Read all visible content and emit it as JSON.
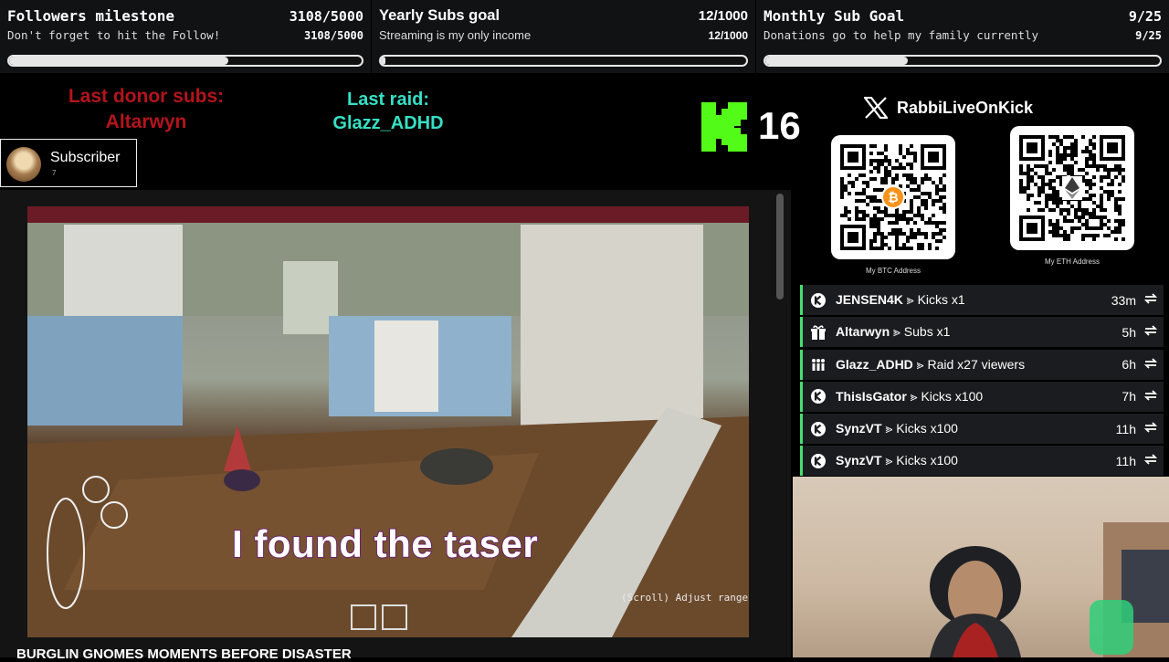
{
  "goals": [
    {
      "title": "Followers milestone",
      "count": "3108/5000",
      "subtitle": "Don't forget to hit the Follow!",
      "subcount": "3108/5000",
      "progress": 0.6216
    },
    {
      "title": "Yearly Subs goal",
      "count": "12/1000",
      "subtitle": "Streaming is my only income",
      "subcount": "12/1000",
      "progress": 0.012
    },
    {
      "title": "Monthly Sub Goal",
      "count": "9/25",
      "subtitle": "Donations go to help my family currently",
      "subcount": "9/25",
      "progress": 0.36
    }
  ],
  "last_donor": {
    "label": "Last donor subs:",
    "name": "Altarwyn"
  },
  "last_raid": {
    "label": "Last raid:",
    "name": "Glazz_ADHD"
  },
  "kick": {
    "icon": "kick-logo-icon",
    "viewers": "16"
  },
  "subscriber_alert": {
    "label": "Subscriber",
    "small": "7"
  },
  "social": {
    "icon": "x-logo-icon",
    "handle": "RabbiLiveOnKick"
  },
  "qr": [
    {
      "caption": "My BTC Address",
      "icon": "bitcoin-icon"
    },
    {
      "caption": "My ETH Address",
      "icon": "ethereum-icon"
    }
  ],
  "events": [
    {
      "icon": "kick-icon",
      "user": "JENSEN4K",
      "action": " ⪢ Kicks x1",
      "time": "33m"
    },
    {
      "icon": "gift-icon",
      "user": "Altarwyn",
      "action": " ⪢ Subs x1",
      "time": "5h"
    },
    {
      "icon": "raid-icon",
      "user": "Glazz_ADHD",
      "action": " ⪢ Raid x27 viewers",
      "time": "6h"
    },
    {
      "icon": "kick-icon",
      "user": "ThisIsGator",
      "action": " ⪢ Kicks x100",
      "time": "7h"
    },
    {
      "icon": "kick-icon",
      "user": "SynzVT",
      "action": " ⪢ Kicks x100",
      "time": "11h"
    },
    {
      "icon": "kick-icon",
      "user": "SynzVT",
      "action": " ⪢ Kicks x100",
      "time": "11h"
    }
  ],
  "game": {
    "subtitle": "I found the taser",
    "hint": "(Scroll) Adjust range",
    "video_title": "BURGLIN GNOMES MOMENTS BEFORE DISASTER"
  },
  "colors": {
    "donor": "#b3141c",
    "raid": "#35e0c4",
    "kick_green": "#53fc18",
    "event_accent": "#44e070"
  }
}
